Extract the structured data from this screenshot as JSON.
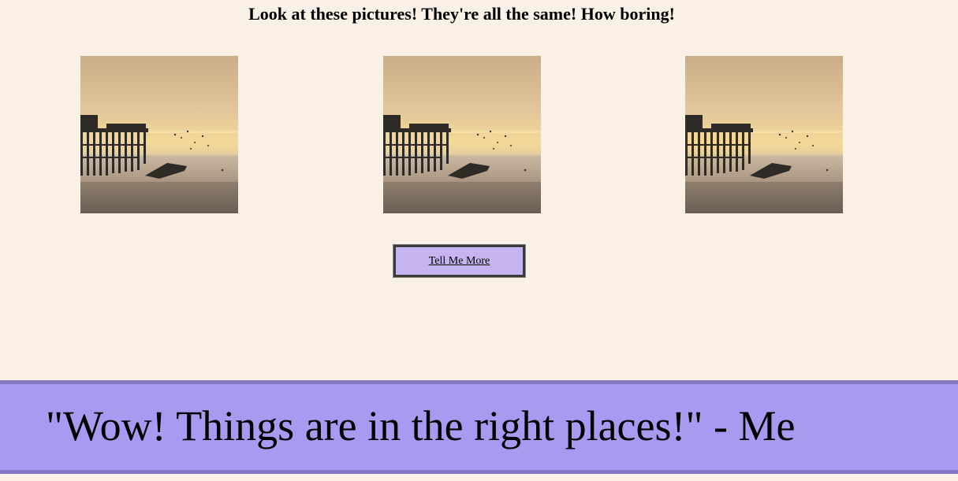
{
  "heading": "Look at these pictures! They're all the same! How boring!",
  "photos": [
    {
      "icon": "pier-at-sunset-image"
    },
    {
      "icon": "pier-at-sunset-image"
    },
    {
      "icon": "pier-at-sunset-image"
    }
  ],
  "button": {
    "label": "Tell Me More"
  },
  "footer": {
    "quote": "\"Wow! Things are in the right places!\" - Me"
  },
  "colors": {
    "page_background": "#faf0e6",
    "button_background": "#c6b4f0",
    "footer_background": "#a89af0",
    "footer_border": "#8577c4"
  }
}
